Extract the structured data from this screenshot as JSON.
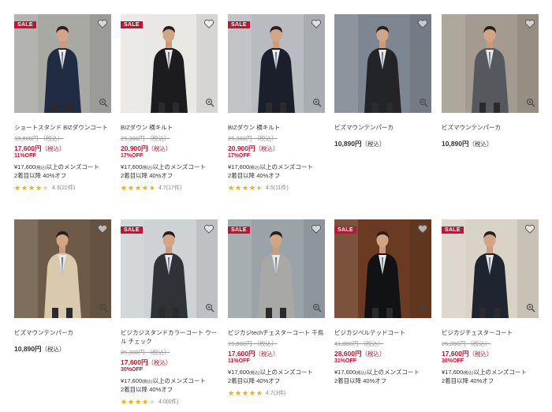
{
  "colors": {
    "sale": "#c4122f",
    "star": "#f4b400"
  },
  "products": [
    {
      "sale": true,
      "sale_label": "SALE",
      "name": "ショートスタンド BIZダウンコート",
      "old_price": "19,800円 （税込）",
      "price": "17,600円",
      "tax": "（税込）",
      "off": "11%OFF",
      "promo1": "¥17,600",
      "promo1b": "(税込)",
      "promo1c": "以上のメンズコート",
      "promo2": "2着目以降 40%オフ",
      "rating": 4.3,
      "rating_text": "4.3",
      "reviews": "(22件)",
      "coat": "#1f2c44",
      "bg": "#a9a9a4"
    },
    {
      "sale": true,
      "sale_label": "SALE",
      "name": "BIZダウン 横キルト",
      "old_price": "25,300円 （税込）",
      "price": "20,900円",
      "tax": "（税込）",
      "off": "17%OFF",
      "promo1": "¥17,600",
      "promo1b": "(税込)",
      "promo1c": "以上のメンズコート",
      "promo2": "2着目以降 40%オフ",
      "rating": 4.7,
      "rating_text": "4.7",
      "reviews": "(17件)",
      "coat": "#1c1c1e",
      "bg": "#e9e8e4"
    },
    {
      "sale": true,
      "sale_label": "SALE",
      "name": "BIZダウン 横キルト",
      "old_price": "25,300円 （税込）",
      "price": "20,900円",
      "tax": "（税込）",
      "off": "17%OFF",
      "promo1": "¥17,600",
      "promo1b": "(税込)",
      "promo1c": "以上のメンズコート",
      "promo2": "2着目以降 40%オフ",
      "rating": 4.5,
      "rating_text": "4.5",
      "reviews": "(11件)",
      "coat": "#1a1f2b",
      "bg": "#b8bcc0"
    },
    {
      "sale": false,
      "sale_label": "",
      "name": "ビズマウンテンパーカ",
      "old_price": "",
      "price": "10,890円",
      "tax": "（税込）",
      "off": "",
      "promo1": "",
      "promo1b": "",
      "promo1c": "",
      "promo2": "",
      "rating": 0,
      "rating_text": "",
      "reviews": "",
      "coat": "#222428",
      "bg": "#7e8691"
    },
    {
      "sale": false,
      "sale_label": "",
      "name": "ビズマウンテンパーカ",
      "old_price": "",
      "price": "10,890円",
      "tax": "（税込）",
      "off": "",
      "promo1": "",
      "promo1b": "",
      "promo1c": "",
      "promo2": "",
      "rating": 0,
      "rating_text": "",
      "reviews": "",
      "coat": "#55595e",
      "bg": "#a39b8f"
    },
    {
      "sale": false,
      "sale_label": "",
      "name": "ビズマウンテンパーカ",
      "old_price": "",
      "price": "10,890円",
      "tax": "（税込）",
      "off": "",
      "promo1": "",
      "promo1b": "",
      "promo1c": "",
      "promo2": "",
      "rating": 0,
      "rating_text": "",
      "reviews": "",
      "coat": "#d9c9ad",
      "bg": "#6d5a47"
    },
    {
      "sale": true,
      "sale_label": "SALE",
      "name": "ビジカジスタンドカラーコート ウール チェック",
      "old_price": "25,300円 （税込）",
      "price": "17,600円",
      "tax": "（税込）",
      "off": "30%OFF",
      "promo1": "¥17,600",
      "promo1b": "(税込)",
      "promo1c": "以上のメンズコート",
      "promo2": "2着目以降 40%オフ",
      "rating": 4.0,
      "rating_text": "4.0",
      "reviews": "(6件)",
      "coat": "#2f3338",
      "bg": "#cfd2d4"
    },
    {
      "sale": true,
      "sale_label": "SALE",
      "name": "ビジカジtechチェスターコート 千鳥",
      "old_price": "19,800円 （税込）",
      "price": "17,600円",
      "tax": "（税込）",
      "off": "11%OFF",
      "promo1": "¥17,600",
      "promo1b": "(税込)",
      "promo1c": "以上のメンズコート",
      "promo2": "2着目以降 40%オフ",
      "rating": 4.7,
      "rating_text": "4.7",
      "reviews": "(3件)",
      "coat": "#a8a8a6",
      "bg": "#9aa3a8"
    },
    {
      "sale": true,
      "sale_label": "SALE",
      "name": "ビジカジベルテッドコート",
      "old_price": "41,800円 （税込）",
      "price": "28,600円",
      "tax": "（税込）",
      "off": "31%OFF",
      "promo1": "¥17,600",
      "promo1b": "(税込)",
      "promo1c": "以上のメンズコート",
      "promo2": "2着目以降 40%オフ",
      "rating": 0,
      "rating_text": "",
      "reviews": "",
      "coat": "#111214",
      "bg": "#6a3b22"
    },
    {
      "sale": true,
      "sale_label": "SALE",
      "name": "ビジカジチェスターコート",
      "old_price": "25,300円 （税込）",
      "price": "17,600円",
      "tax": "（税込）",
      "off": "30%OFF",
      "promo1": "¥17,600",
      "promo1b": "(税込)",
      "promo1c": "以上のメンズコート",
      "promo2": "2着目以降 40%オフ",
      "rating": 0,
      "rating_text": "",
      "reviews": "",
      "coat": "#1e2430",
      "bg": "#d9d2c6"
    }
  ]
}
